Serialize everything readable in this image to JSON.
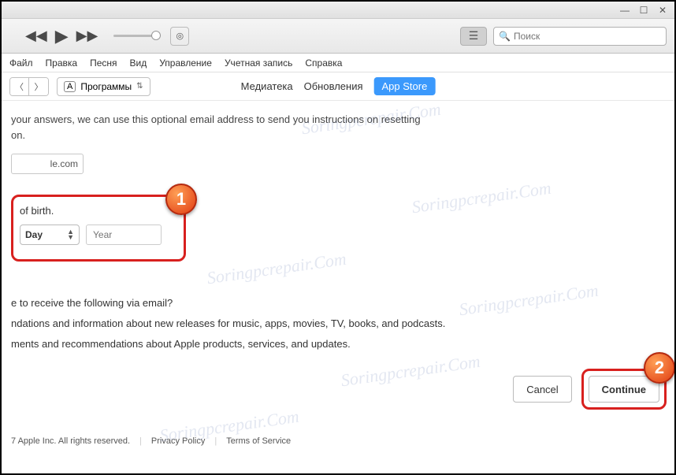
{
  "titlebar": {
    "minimize": "—",
    "maximize": "☐",
    "close": "✕"
  },
  "toolbar": {
    "search_placeholder": "Поиск",
    "apple_glyph": ""
  },
  "menubar": [
    "Файл",
    "Правка",
    "Песня",
    "Вид",
    "Управление",
    "Учетная запись",
    "Справка"
  ],
  "navbar": {
    "category": "Программы",
    "tabs": {
      "media": "Медиатека",
      "updates": "Обновления",
      "store": "App Store"
    }
  },
  "content": {
    "intro_line1": "your answers, we can use this optional email address to send you instructions on resetting",
    "intro_line2": "on.",
    "email_suffix": "le.com",
    "birth_label": "of birth.",
    "day_label": "Day",
    "year_placeholder": "Year",
    "prefs_q": "e to receive the following via email?",
    "prefs_l1": "ndations and information about new releases for music, apps, movies, TV, books, and podcasts.",
    "prefs_l2": "ments and recommendations about Apple products, services, and updates.",
    "cancel": "Cancel",
    "continue": "Continue",
    "badge1": "1",
    "badge2": "2"
  },
  "footer": {
    "copyright": "7 Apple Inc. All rights reserved.",
    "privacy": "Privacy Policy",
    "terms": "Terms of Service"
  },
  "watermark": "Soringpcrepair.Com"
}
